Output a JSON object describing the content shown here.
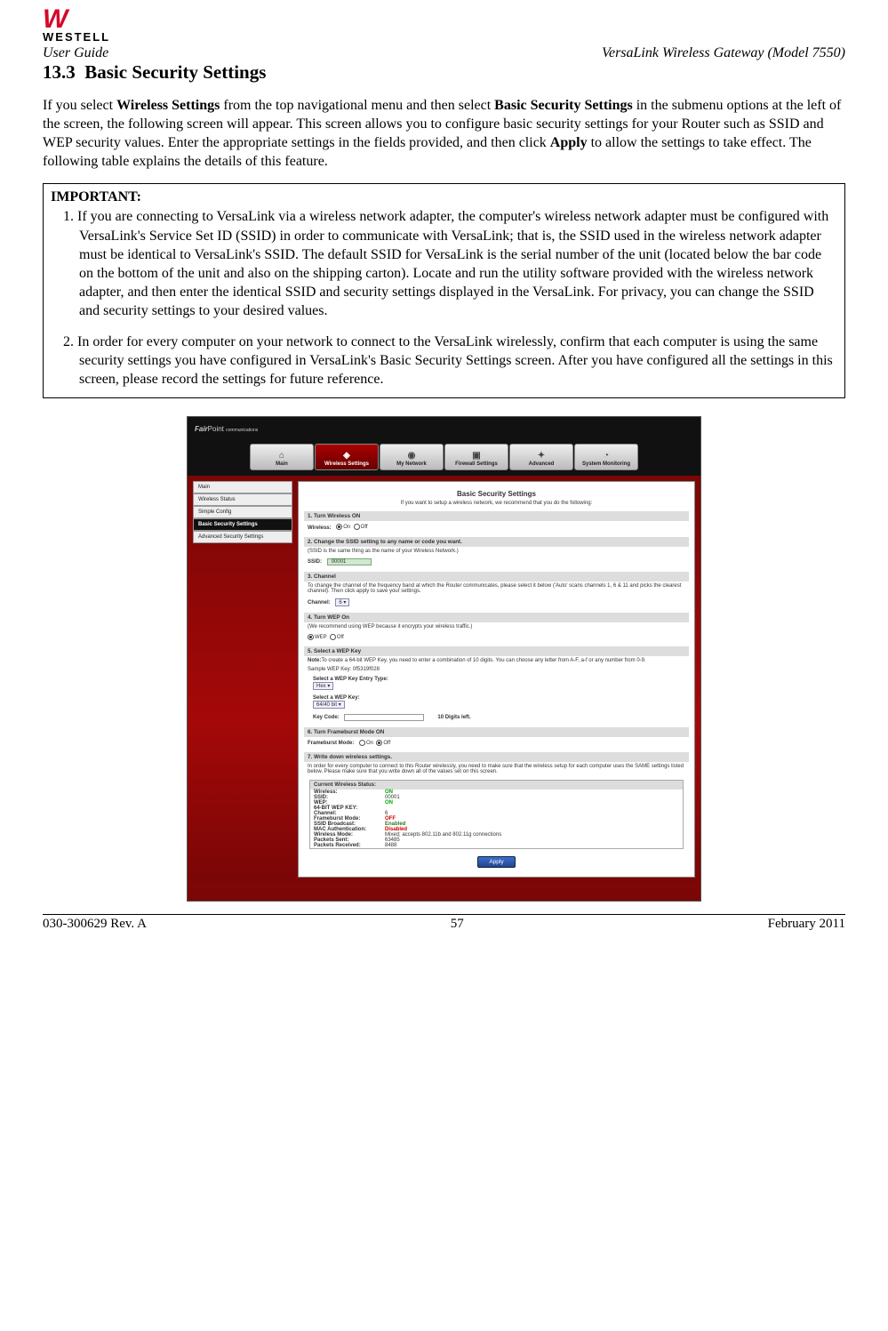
{
  "logo": {
    "mark": "W",
    "brand": "WESTELL"
  },
  "header": {
    "left": "User Guide",
    "right": "VersaLink Wireless Gateway (Model 7550)"
  },
  "section": {
    "number": "13.3",
    "title": "Basic Security Settings"
  },
  "intro": {
    "p1a": "If you select ",
    "p1b": "Wireless Settings",
    "p1c": " from the top navigational menu and then select ",
    "p1d": "Basic Security Settings",
    "p1e": " in the submenu options at the left of the screen, the following screen will appear. This screen allows you to configure basic security settings for your Router such as SSID and WEP security values. Enter the appropriate settings in the fields provided, and then click ",
    "p1f": "Apply",
    "p1g": " to allow the settings to take effect. The following table explains the details of this feature."
  },
  "important": {
    "heading": "IMPORTANT:",
    "item1": "1. If you are connecting to VersaLink via a wireless network adapter, the computer's wireless network adapter must be configured with VersaLink's Service Set ID (SSID) in order to communicate with VersaLink; that is, the SSID used in the wireless network adapter must be identical to VersaLink's SSID. The default SSID for VersaLink is the serial number of the unit (located below the bar code on the bottom of the unit and also on the shipping carton). Locate and run the utility software provided with the wireless network adapter, and then enter the identical SSID and security settings displayed in the VersaLink. For privacy, you can change the SSID and security settings to your desired values.",
    "item2": "2. In order for every computer on your network to connect to the VersaLink wirelessly, confirm that each computer is using the same security settings you have configured in VersaLink's Basic Security Settings screen. After you have configured all the settings in this screen, please record the settings for future reference."
  },
  "screenshot": {
    "topbar": {
      "brandA": "Fair",
      "brandB": "Point",
      "sub": "communications"
    },
    "tabs": [
      "Main",
      "Wireless Settings",
      "My Network",
      "Firewall Settings",
      "Advanced",
      "System Monitoring"
    ],
    "tabs_active_index": 1,
    "sidebar": [
      "Main",
      "Wireless Status",
      "Simple Config",
      "Basic Security Settings",
      "Advanced Security Settings"
    ],
    "sidebar_sel_index": 3,
    "panel": {
      "title": "Basic Security Settings",
      "subtitle": "If you want to setup a wireless network, we recommend that you do the following:",
      "s1": {
        "head": "1. Turn Wireless ON",
        "label": "Wireless:",
        "optOn": "On",
        "optOff": "Off"
      },
      "s2": {
        "head": "2. Change the SSID setting to any name or code you want.",
        "note": "(SSID is the same thing as the name of your Wireless Network.)",
        "label": "SSID:",
        "value": "00001"
      },
      "s3": {
        "head": "3. Channel",
        "note": "To change the channel of the frequency band at which the Router communicates, please select it below ('Auto' scans channels 1, 6 & 11 and picks the clearest channel). Then click apply to save your settings.",
        "label": "Channel:",
        "value": "6"
      },
      "s4": {
        "head": "4. Turn WEP On",
        "note": "(We recommend using WEP because it encrypts your wireless traffic.)",
        "optWep": "WEP",
        "optOff": "Off"
      },
      "s5": {
        "head": "5. Select a WEP Key",
        "note1a": "Note:",
        "note1b": "To create a 64-bit WEP Key, you need to enter a combination of 10 digits. You can choose any letter from A-F, a-f or any number from 0-9.",
        "sample": "Sample WEP Key: 0f5319f028",
        "entryLabel": "Select a WEP Key Entry Type:",
        "entryValue": "Hex",
        "keySelLabel": "Select a WEP Key:",
        "keySelValue": "64/40 bit",
        "keyCodeLabel": "Key Code:",
        "left": "10 Digits left."
      },
      "s6": {
        "head": "6. Turn Frameburst Mode ON",
        "label": "Frameburst Mode:",
        "optOn": "On",
        "optOff": "Off"
      },
      "s7": {
        "head": "7. Write down wireless settings.",
        "note": "In order for every computer to connect to this Router wirelessly, you need to make sure that the wireless setup for each computer uses the SAME settings listed below. Please make sure that you write down all of the values set on this screen."
      },
      "status": {
        "head": "Current Wireless Status:",
        "rows": [
          {
            "k": "Wireless:",
            "v": "ON",
            "cls": "on"
          },
          {
            "k": "SSID:",
            "v": "00001"
          },
          {
            "k": "WEP:",
            "v": "ON",
            "cls": "on"
          },
          {
            "k": "64-BIT WEP KEY:",
            "v": ""
          },
          {
            "k": "Channel:",
            "v": "6"
          },
          {
            "k": "Frameburst Mode:",
            "v": "OFF",
            "cls": "off"
          },
          {
            "k": "SSID Broadcast:",
            "v": "Enabled",
            "cls": "en"
          },
          {
            "k": "MAC Authentication:",
            "v": "Disabled",
            "cls": "off"
          },
          {
            "k": "Wireless Mode:",
            "v": "Mixed; accepts 802.11b and 802.11g connections"
          },
          {
            "k": "Packets Sent:",
            "v": "63485"
          },
          {
            "k": "Packets Received:",
            "v": "8488"
          }
        ]
      },
      "apply": "Apply"
    }
  },
  "footer": {
    "left": "030-300629 Rev. A",
    "center": "57",
    "right": "February 2011"
  }
}
